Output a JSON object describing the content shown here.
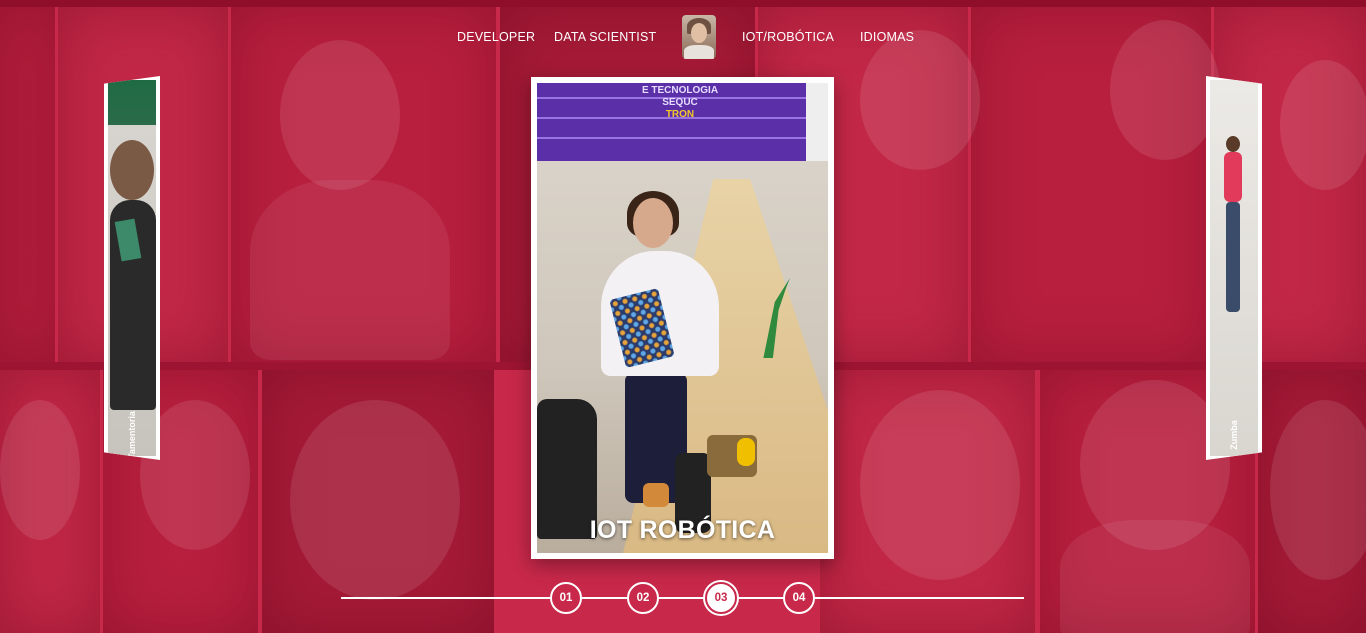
{
  "nav": {
    "items": [
      {
        "label": "DEVELOPER"
      },
      {
        "label": "DATA SCIENTIST"
      },
      {
        "label": "IOT/ROBÓTICA"
      },
      {
        "label": "IDIOMAS"
      }
    ],
    "avatar_icon": "profile-photo"
  },
  "slides": {
    "left_caption": "Tamentoria",
    "right_caption": "Zumba",
    "current_label": "IOT ROBÓTICA",
    "sign_text": "E TECNOLOGIA SEQUC",
    "sign_tron": "TRON"
  },
  "pager": {
    "items": [
      "01",
      "02",
      "03",
      "04"
    ],
    "active_index": 2
  },
  "colors": {
    "brand_red": "#c8284a",
    "white": "#ffffff"
  }
}
